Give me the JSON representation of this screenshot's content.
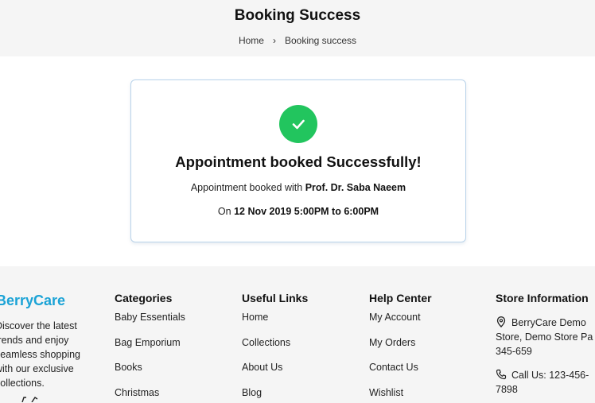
{
  "header": {
    "title": "Booking Success",
    "breadcrumb": {
      "home": "Home",
      "separator": "›",
      "current": "Booking success"
    }
  },
  "card": {
    "icon": "check-circle-icon",
    "title": "Appointment booked Successfully!",
    "doctor_prefix": "Appointment booked with ",
    "doctor_name": "Prof. Dr. Saba Naeem",
    "date_prefix": "On ",
    "date_value": "12 Nov 2019 5:00PM to 6:00PM",
    "accent": "#22c55e"
  },
  "footer": {
    "brand": "BerryCare",
    "brand_color": "#1ba3d6",
    "description": "Discover the latest trends and enjoy seamless shopping with our exclusive collections.",
    "columns": {
      "categories": {
        "title": "Categories",
        "items": [
          "Baby Essentials",
          "Bag Emporium",
          "Books",
          "Christmas"
        ]
      },
      "useful_links": {
        "title": "Useful Links",
        "items": [
          "Home",
          "Collections",
          "About Us",
          "Blog"
        ]
      },
      "help_center": {
        "title": "Help Center",
        "items": [
          "My Account",
          "My Orders",
          "Contact Us",
          "Wishlist"
        ]
      },
      "store_info": {
        "title": "Store Information",
        "address": "BerryCare Demo Store, Demo Store Pa 345-659",
        "phone": "Call Us: 123-456-7898"
      }
    }
  }
}
